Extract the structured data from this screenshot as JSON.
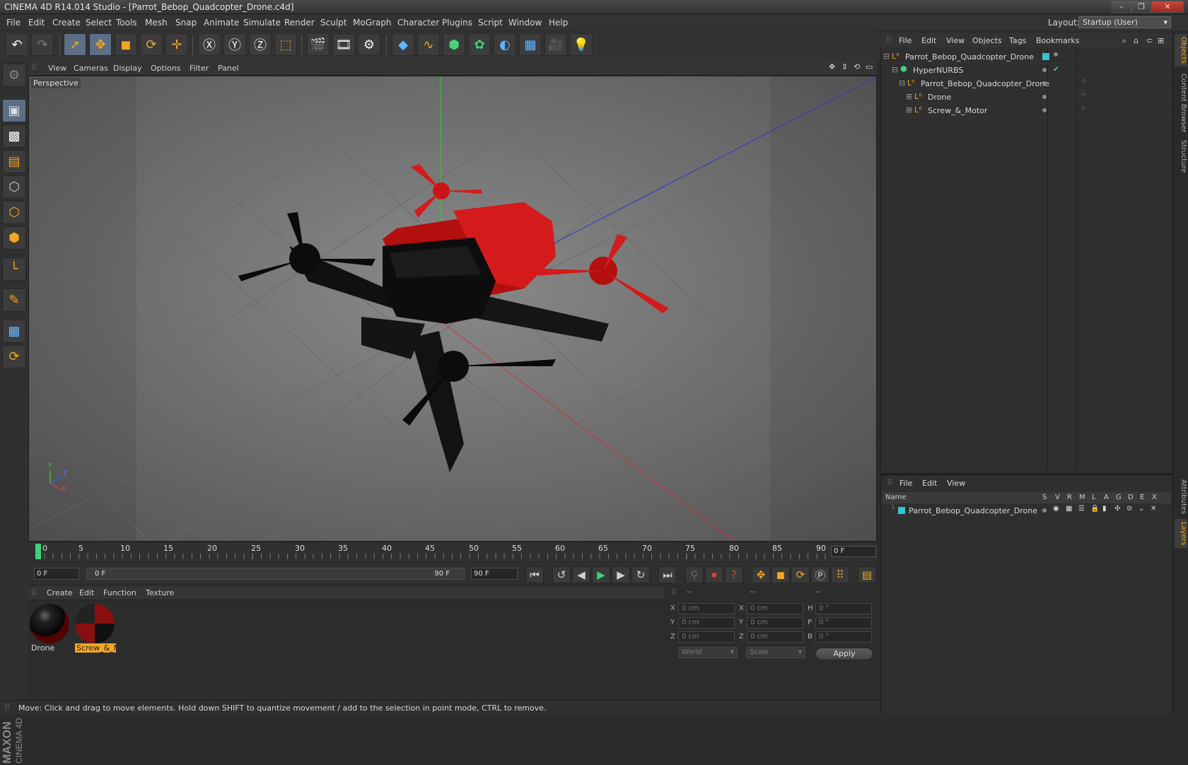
{
  "window": {
    "title": "CINEMA 4D R14.014 Studio - [Parrot_Bebop_Quadcopter_Drone.c4d]",
    "minimize": "–",
    "maximize": "❐",
    "close": "✕"
  },
  "menubar": {
    "items": [
      "File",
      "Edit",
      "Create",
      "Select",
      "Tools",
      "Mesh",
      "Snap",
      "Animate",
      "Simulate",
      "Render",
      "Sculpt",
      "MoGraph",
      "Character",
      "Plugins",
      "Script",
      "Window",
      "Help"
    ],
    "layout_label": "Layout:",
    "layout_value": "Startup (User)"
  },
  "viewport": {
    "menu": [
      "View",
      "Cameras",
      "Display",
      "Options",
      "Filter",
      "Panel"
    ],
    "camera_label": "Perspective",
    "axis_labels": {
      "y": "Y",
      "z": "Z",
      "x": "X"
    }
  },
  "timeline": {
    "ticks": [
      "0",
      "5",
      "10",
      "15",
      "20",
      "25",
      "30",
      "35",
      "40",
      "45",
      "50",
      "55",
      "60",
      "65",
      "70",
      "75",
      "80",
      "85",
      "90"
    ],
    "current_frame": "0 F"
  },
  "transport": {
    "start_field": "0 F",
    "range_start": "0 F",
    "range_end": "90 F",
    "end_field": "90 F"
  },
  "materials": {
    "menu": [
      "Create",
      "Edit",
      "Function",
      "Texture"
    ],
    "items": [
      {
        "name": "Drone",
        "selected": false
      },
      {
        "name": "Screw_&_M",
        "selected": true
      }
    ]
  },
  "coordinates": {
    "header": [
      "--",
      "--",
      "--"
    ],
    "rows": [
      {
        "a_label": "X",
        "a_val": "0 cm",
        "b_label": "X",
        "b_val": "0 cm",
        "c_label": "H",
        "c_val": "0 °"
      },
      {
        "a_label": "Y",
        "a_val": "0 cm",
        "b_label": "Y",
        "b_val": "0 cm",
        "c_label": "P",
        "c_val": "0 °"
      },
      {
        "a_label": "Z",
        "a_val": "0 cm",
        "b_label": "Z",
        "b_val": "0 cm",
        "c_label": "B",
        "c_val": "0 °"
      }
    ],
    "mode1": "World",
    "mode2": "Scale",
    "apply": "Apply"
  },
  "status": {
    "text": "Move: Click and drag to move elements. Hold down SHIFT to quantize movement / add to the selection in point mode, CTRL to remove."
  },
  "objects_panel": {
    "menu": [
      "File",
      "Edit",
      "View",
      "Objects",
      "Tags",
      "Bookmarks"
    ],
    "rows": [
      {
        "name": "Parrot_Bebop_Quadcopter_Drone",
        "indent": 0
      },
      {
        "name": "HyperNURBS",
        "indent": 1
      },
      {
        "name": "Parrot_Bebop_Quadcopter_Drone",
        "indent": 2
      },
      {
        "name": "Drone",
        "indent": 3
      },
      {
        "name": "Screw_&_Motor",
        "indent": 3
      }
    ]
  },
  "layers_panel": {
    "menu": [
      "File",
      "Edit",
      "View"
    ],
    "columns": [
      "Name",
      "S",
      "V",
      "R",
      "M",
      "L",
      "A",
      "G",
      "D",
      "E",
      "X"
    ],
    "rows": [
      {
        "name": "Parrot_Bebop_Quadcopter_Drone"
      }
    ]
  },
  "right_tabs": [
    "Objects",
    "Content Browser",
    "Structure",
    "Attributes",
    "Layers"
  ],
  "brand": {
    "maxon": "MAXON",
    "c4d": "CINEMA 4D"
  },
  "colors": {
    "accent": "#f5a623",
    "selection": "#5c6f86",
    "layer_color": "#35c6d0",
    "drone_red": "#d41a1a"
  }
}
